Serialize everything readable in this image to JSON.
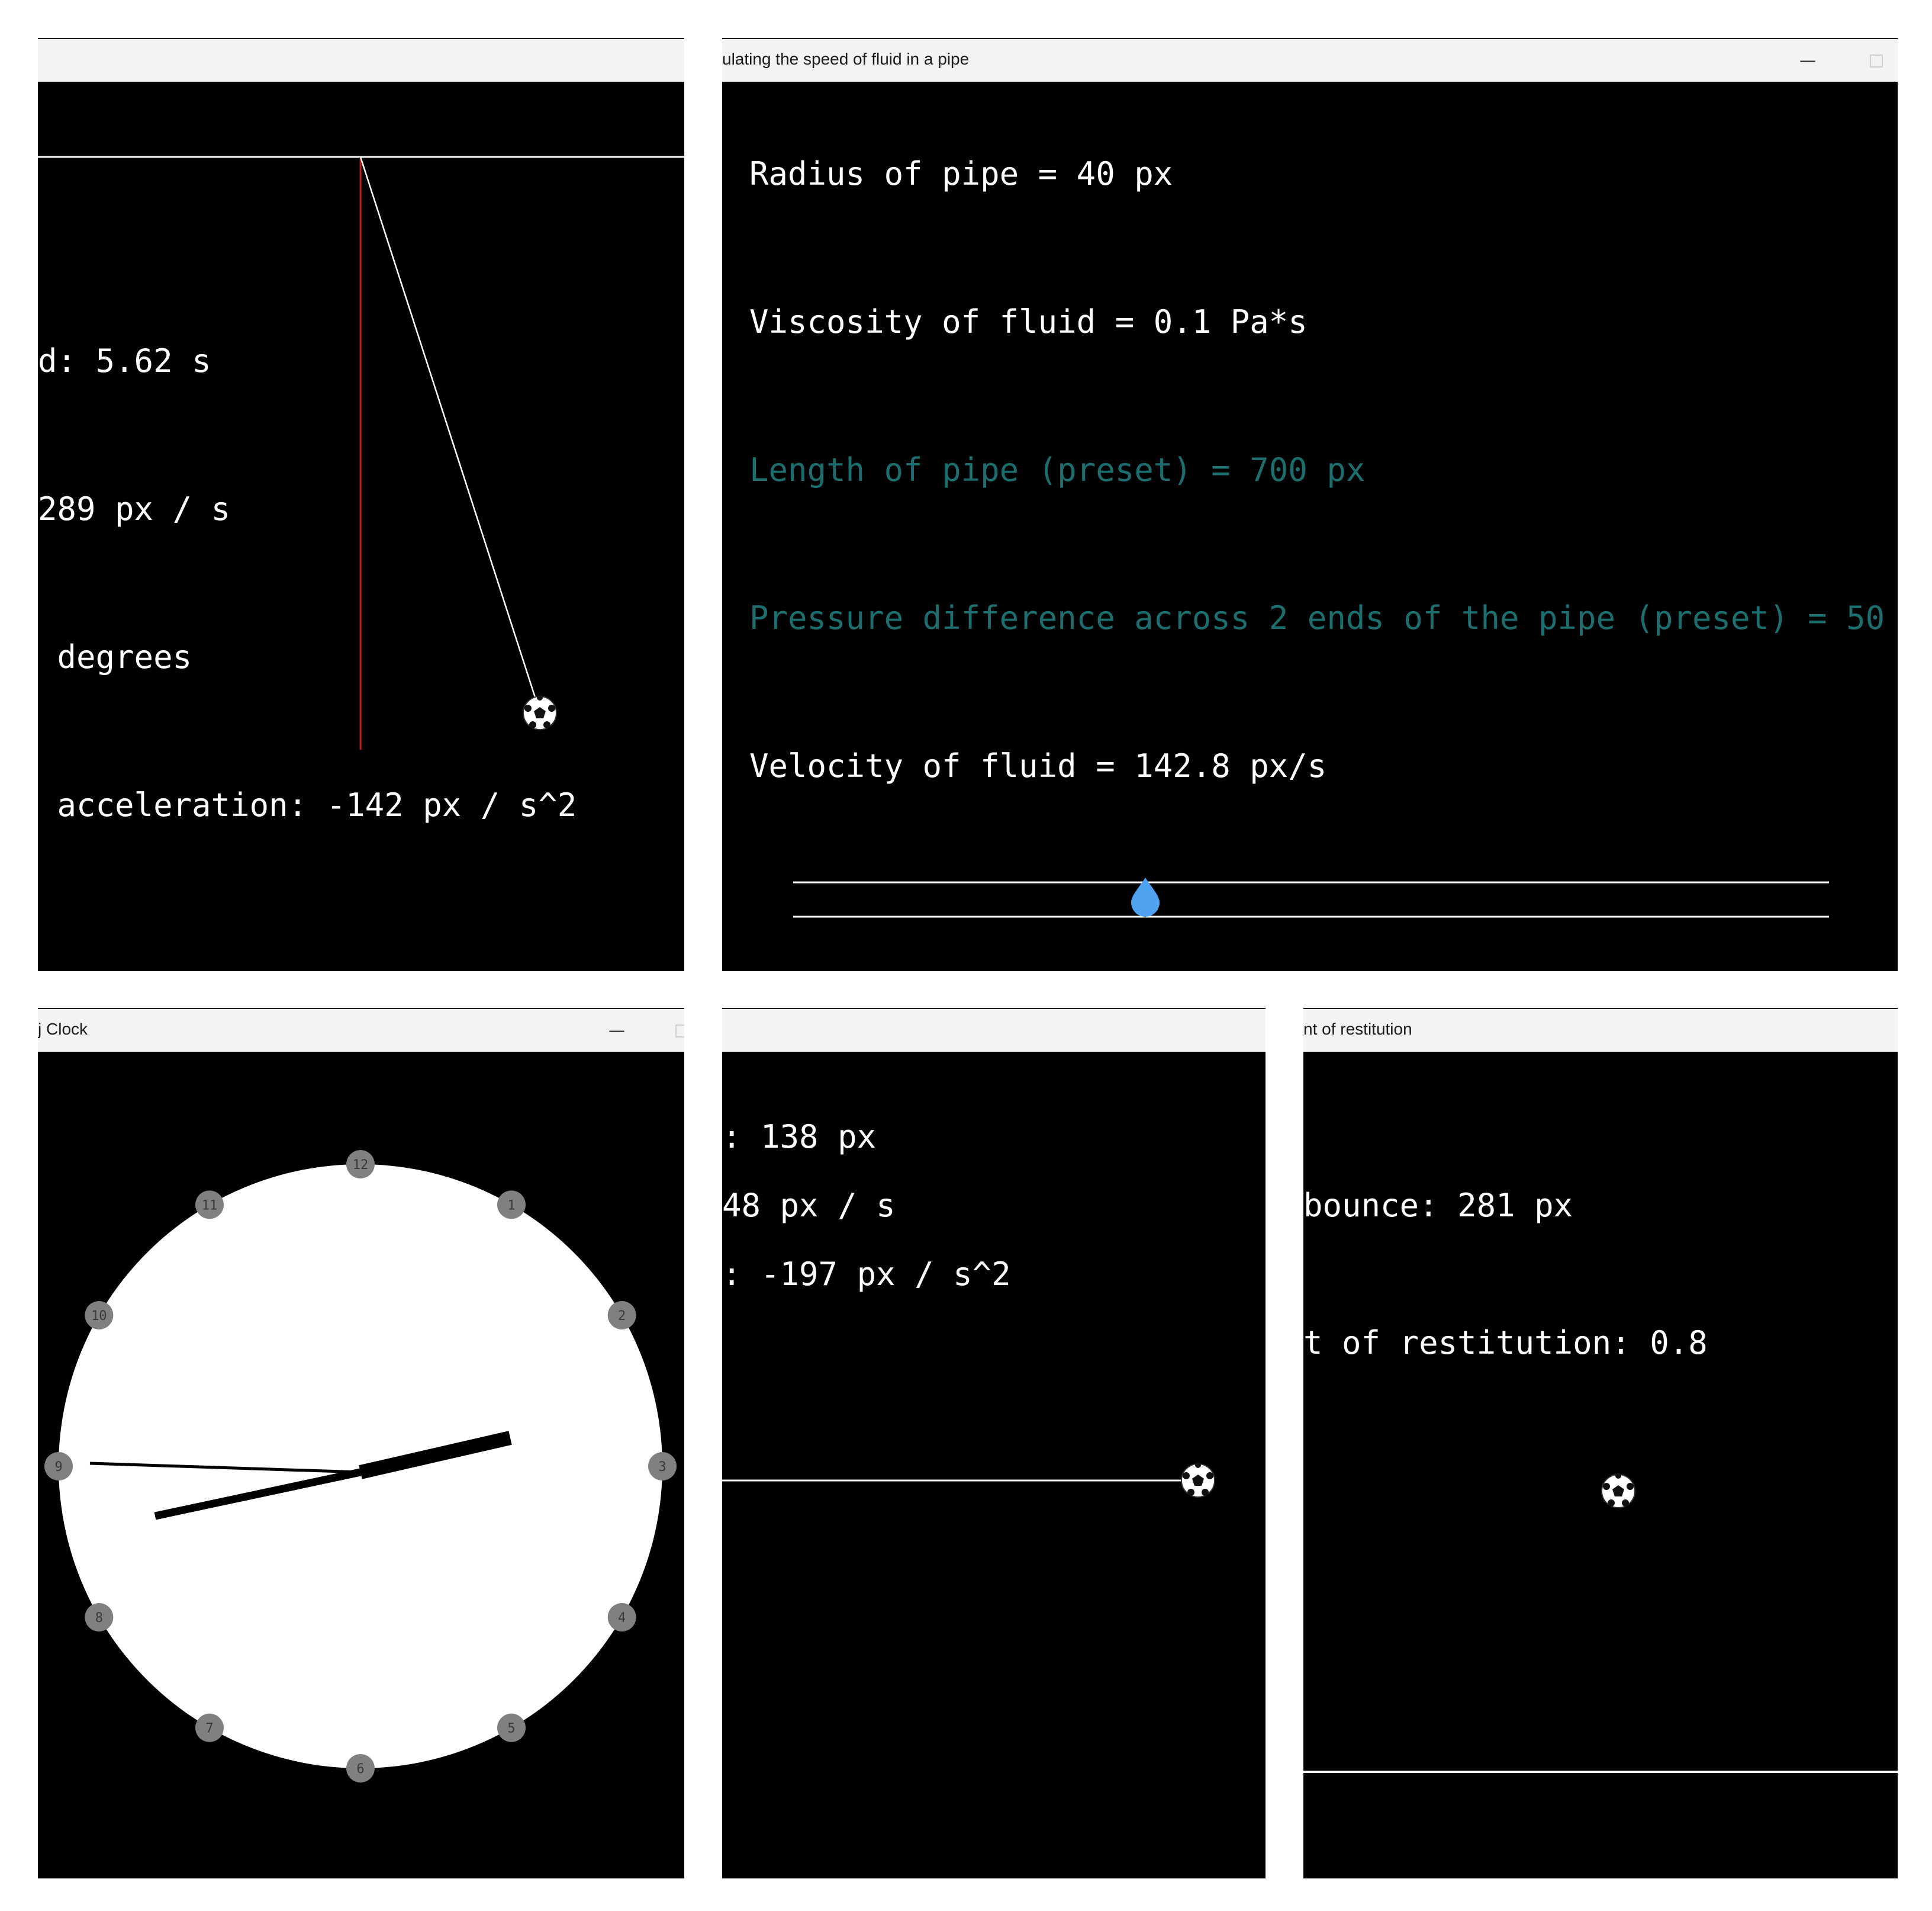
{
  "colors": {
    "background": "#000000",
    "text": "#ffffff",
    "preset_text": "#1d6e6e",
    "pendulum_reference": "#cc1a1a",
    "droplet": "#4fa3f0",
    "clock_marker": "#808080",
    "titlebar": "#f3f3f3"
  },
  "windows": {
    "pendulum": {
      "title": "",
      "period": "d: 5.62 s",
      "velocity": "289 px / s",
      "angle": " degrees",
      "acceleration": " acceleration: -142 px / s^2",
      "ball_icon": "soccer-ball-icon"
    },
    "pipe": {
      "title": "ulating the speed of fluid in a pipe",
      "minimize": "—",
      "radius": "Radius of pipe = 40 px",
      "viscosity": "Viscosity of fluid = 0.1 Pa*s",
      "length": "Length of pipe (preset) = 700 px",
      "pressure": "Pressure difference across 2 ends of the pipe (preset) = 50",
      "velocity": "Velocity of fluid = 142.8 px/s",
      "droplet_icon": "water-drop-icon",
      "droplet_progress": 0.34
    },
    "clock": {
      "title": "j Clock",
      "minimize": "—",
      "hours": [
        "12",
        "1",
        "2",
        "3",
        "4",
        "5",
        "6",
        "7",
        "8",
        "9",
        "10",
        "11"
      ]
    },
    "projectile": {
      "title": "",
      "height": ": 138 px",
      "velocity": "48 px / s",
      "acceleration": ": -197 px / s^2",
      "ball_icon": "soccer-ball-icon"
    },
    "bounce": {
      "title": "nt of restitution",
      "bounce_height": "bounce: 281 px",
      "restitution": "t of restitution: 0.8",
      "ball_icon": "soccer-ball-icon"
    }
  }
}
